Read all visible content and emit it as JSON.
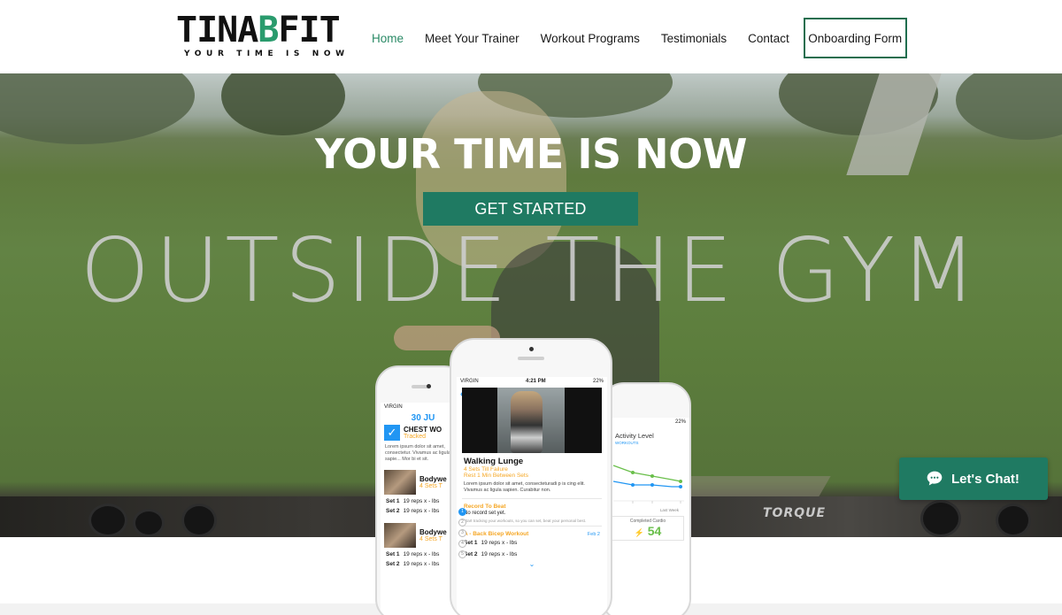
{
  "header": {
    "logo": {
      "brand_left": "TINA",
      "brand_accent": "B",
      "brand_right": "FIT",
      "tagline": "YOUR TIME IS NOW"
    },
    "nav": [
      {
        "label": "Home",
        "active": true
      },
      {
        "label": "Meet Your Trainer",
        "active": false
      },
      {
        "label": "Workout Programs",
        "active": false
      },
      {
        "label": "Testimonials",
        "active": false
      },
      {
        "label": "Contact",
        "active": false
      }
    ],
    "cta_label": "Onboarding Form"
  },
  "hero": {
    "title": "YOUR TIME IS NOW",
    "button_label": "GET STARTED",
    "background_text": "OUTSIDE THE GYM",
    "equipment_text": "TORQUE"
  },
  "phone_left": {
    "carrier": "VIRGIN",
    "date": "30 JU",
    "check_title": "CHEST WO",
    "check_status": "Tracked",
    "lorem": "Lorem ipsum dolor sit amet, consectetur. Vivamus ac ligula sapie... Mor bi et sit.",
    "workouts": [
      {
        "name": "Bodywe",
        "sub": "4 Sets T",
        "sets": [
          {
            "set": "Set 1",
            "detail": "19 reps x - lbs"
          },
          {
            "set": "Set 2",
            "detail": "19 reps x - lbs"
          }
        ]
      },
      {
        "name": "Bodywe",
        "sub": "4 Sets T",
        "sets": [
          {
            "set": "Set 1",
            "detail": "19 reps x - lbs"
          },
          {
            "set": "Set 2",
            "detail": "19 reps x - lbs"
          }
        ]
      }
    ]
  },
  "phone_center": {
    "carrier": "VIRGIN",
    "time": "4:21 PM",
    "battery": "22%",
    "exercise": "Walking Lunge",
    "sets_till_failure": "4 Sets Till Failure",
    "rest": "Rest 1 Min Between Sets",
    "lorem": "Lorem ipsum dolor sit amet, consecteturadi p is cing elit. Vivamus ac ligula sapien. Curabitur non.",
    "record_title": "Record To Beat",
    "record_text": "No record set yet.",
    "record_hint": "Start tracking your workouts, so you can set, beat your personal best.",
    "workout_title": "A - Back Bicep Workout",
    "workout_date": "Feb 2",
    "sets": [
      {
        "set": "Set 1",
        "detail": "19 reps x - lbs"
      },
      {
        "set": "Set 2",
        "detail": "19 reps x - lbs"
      }
    ],
    "steps": [
      "1",
      "2",
      "3",
      "4",
      "5"
    ]
  },
  "phone_right": {
    "battery": "22%",
    "chart_title": "Activity Level",
    "legend": "WORKOUTS",
    "axis_label": "Last Week",
    "cardio_label": "Completed Cardio",
    "cardio_value": "54"
  },
  "chat": {
    "label": "Let's Chat!"
  },
  "colors": {
    "accent": "#1f7a62",
    "nav_active": "#2a8a66",
    "app_blue": "#2196f3",
    "app_orange": "#f5a623",
    "app_green": "#6abf4b"
  }
}
